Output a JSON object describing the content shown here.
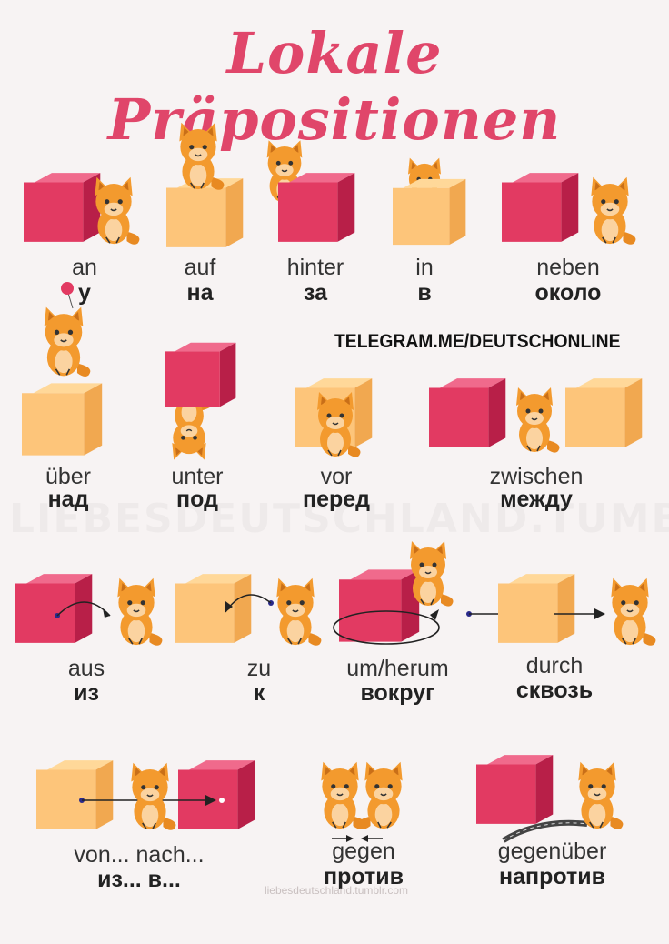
{
  "title": "Lokale Präpositionen",
  "telegram": "TELEGRAM.ME/DEUTSCHONLINE",
  "watermark": "LIEBESDEUTSCHLAND.TUMBLR.COM",
  "credit": "liebesdeutschland.tumblr.com",
  "colors": {
    "title": "#e0466a",
    "red_cube": "#e23a62",
    "orange_cube": "#fdbf6c",
    "cat": "#f39a2e"
  },
  "prepositions": [
    {
      "id": "an",
      "de": "an",
      "ru": "у"
    },
    {
      "id": "auf",
      "de": "auf",
      "ru": "на"
    },
    {
      "id": "hinter",
      "de": "hinter",
      "ru": "за"
    },
    {
      "id": "in",
      "de": "in",
      "ru": "в"
    },
    {
      "id": "neben",
      "de": "neben",
      "ru": "около"
    },
    {
      "id": "ueber",
      "de": "über",
      "ru": "над"
    },
    {
      "id": "unter",
      "de": "unter",
      "ru": "под"
    },
    {
      "id": "vor",
      "de": "vor",
      "ru": "перед"
    },
    {
      "id": "zwischen",
      "de": "zwischen",
      "ru": "между"
    },
    {
      "id": "aus",
      "de": "aus",
      "ru": "из"
    },
    {
      "id": "zu",
      "de": "zu",
      "ru": "к"
    },
    {
      "id": "um",
      "de": "um/herum",
      "ru": "вокруг"
    },
    {
      "id": "durch",
      "de": "durch",
      "ru": "сквозь"
    },
    {
      "id": "vonnach",
      "de": "von... nach...",
      "ru": "из... в..."
    },
    {
      "id": "gegen",
      "de": "gegen",
      "ru": "против"
    },
    {
      "id": "gegenueber",
      "de": "gegenüber",
      "ru": "напротив"
    }
  ]
}
